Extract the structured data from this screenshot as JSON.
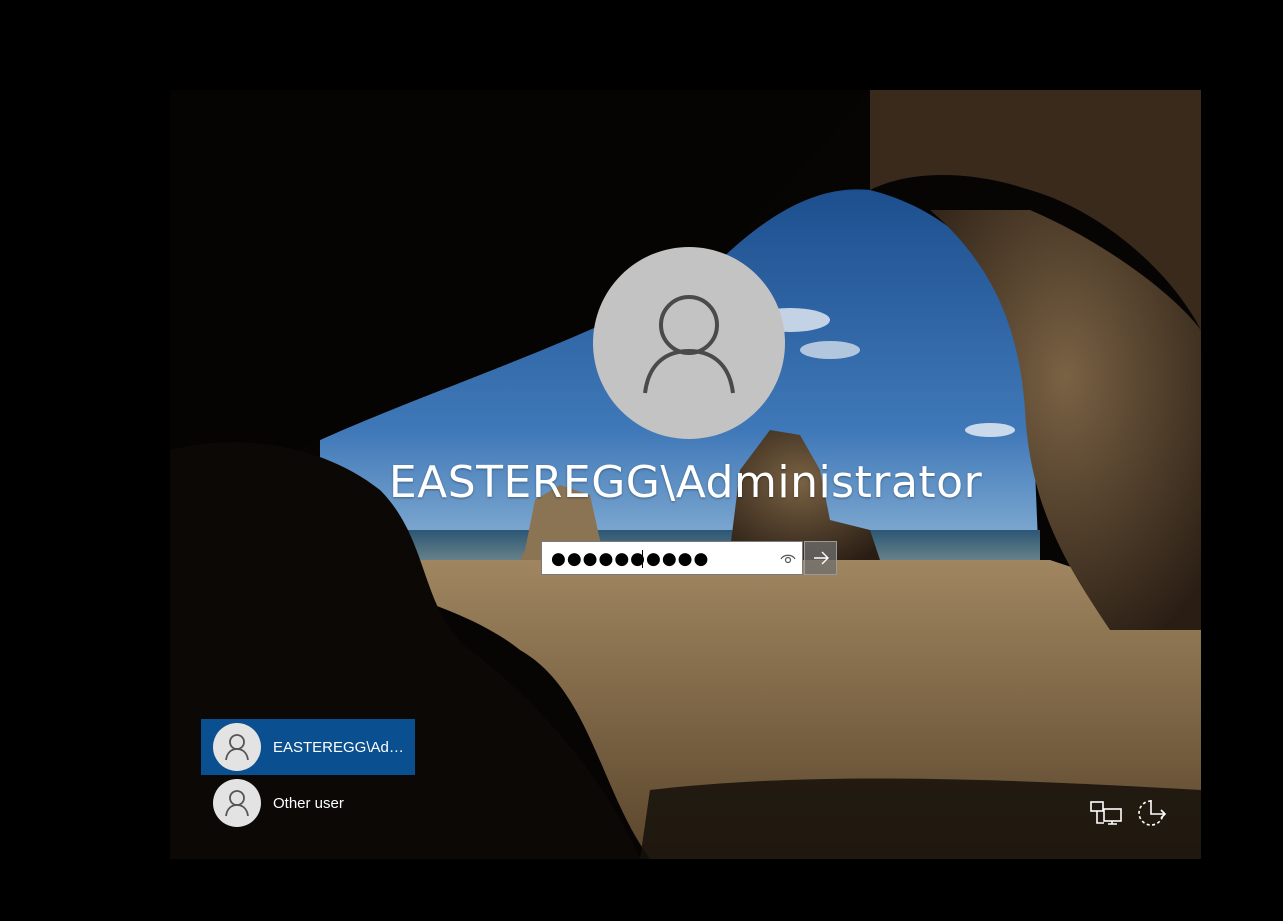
{
  "login": {
    "username": "EASTEREGG\\Administrator",
    "password_mask": "●●●●●●●●●●"
  },
  "user_list": [
    {
      "label": "EASTEREGG\\Admi...",
      "selected": true
    },
    {
      "label": "Other user",
      "selected": false
    }
  ],
  "icons": {
    "avatar": "user-silhouette-icon",
    "reveal": "eye-icon",
    "submit": "arrow-right-icon",
    "network": "network-icon",
    "accessibility": "ease-of-access-icon"
  },
  "colors": {
    "selected_tile": "#0a4f8f",
    "avatar_bg": "#c3c3c3"
  }
}
